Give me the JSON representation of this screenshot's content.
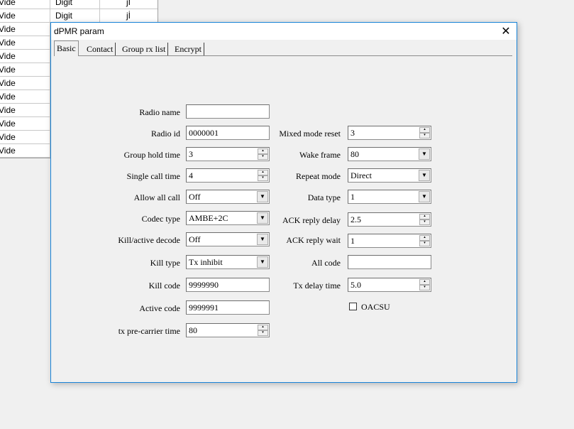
{
  "background_table": {
    "rows": [
      {
        "c1": "Vide",
        "c2": "Digit",
        "c3": "jİ"
      },
      {
        "c1": "Vide",
        "c2": "Digit",
        "c3": "jİ"
      },
      {
        "c1": "Vide",
        "c2": "",
        "c3": ""
      },
      {
        "c1": "Vide",
        "c2": "",
        "c3": ""
      },
      {
        "c1": "Vide",
        "c2": "",
        "c3": ""
      },
      {
        "c1": "Vide",
        "c2": "",
        "c3": ""
      },
      {
        "c1": "Vide",
        "c2": "",
        "c3": ""
      },
      {
        "c1": "Vide",
        "c2": "",
        "c3": ""
      },
      {
        "c1": "Vide",
        "c2": "",
        "c3": ""
      },
      {
        "c1": "Vide",
        "c2": "",
        "c3": ""
      },
      {
        "c1": "Vide",
        "c2": "",
        "c3": ""
      },
      {
        "c1": "Vide",
        "c2": "",
        "c3": ""
      }
    ]
  },
  "dialog": {
    "title": "dPMR param",
    "close_glyph": "✕",
    "tabs": [
      "Basic",
      "Contact",
      "Group rx list",
      "Encrypt"
    ]
  },
  "left": {
    "radio_name": {
      "label": "Radio name",
      "value": ""
    },
    "radio_id": {
      "label": "Radio id",
      "value": "0000001"
    },
    "group_hold_time": {
      "label": "Group hold time",
      "value": "3"
    },
    "single_call_time": {
      "label": "Single call time",
      "value": "4"
    },
    "allow_all_call": {
      "label": "Allow all call",
      "value": "Off"
    },
    "codec_type": {
      "label": "Codec type",
      "value": "AMBE+2C"
    },
    "kill_active_decode": {
      "label": "Kill/active decode",
      "value": "Off"
    },
    "kill_type": {
      "label": "Kill type",
      "value": "Tx inhibit"
    },
    "kill_code": {
      "label": "Kill code",
      "value": "9999990"
    },
    "active_code": {
      "label": "Active code",
      "value": "9999991"
    },
    "tx_precarrier_time": {
      "label": "tx pre-carrier time",
      "value": "80"
    }
  },
  "right": {
    "mixed_mode_reset": {
      "label": "Mixed mode reset",
      "value": "3"
    },
    "wake_frame": {
      "label": "Wake frame",
      "value": "80"
    },
    "repeat_mode": {
      "label": "Repeat mode",
      "value": "Direct"
    },
    "data_type": {
      "label": "Data type",
      "value": "1"
    },
    "ack_reply_delay": {
      "label": "ACK reply delay",
      "value": "2.5"
    },
    "ack_reply_wait": {
      "label": "ACK reply wait",
      "value": "1"
    },
    "all_code": {
      "label": "All code",
      "value": ""
    },
    "tx_delay_time": {
      "label": "Tx delay time",
      "value": "5.0"
    },
    "oacsu": {
      "label": "OACSU",
      "checked": false
    }
  },
  "glyphs": {
    "up": "▴",
    "down": "▾",
    "dropdown": "▼"
  }
}
